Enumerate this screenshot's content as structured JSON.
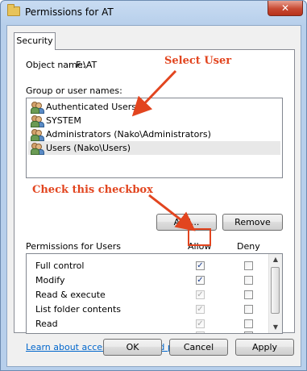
{
  "window": {
    "title": "Permissions for AT",
    "close_glyph": "✕"
  },
  "tab": {
    "label": "Security"
  },
  "object": {
    "label": "Object name:",
    "value": "F:\\AT"
  },
  "group_label": "Group or user names:",
  "users": [
    {
      "name": "Authenticated Users"
    },
    {
      "name": "SYSTEM"
    },
    {
      "name": "Administrators (Nako\\Administrators)"
    },
    {
      "name": "Users (Nako\\Users)",
      "selected": true
    }
  ],
  "buttons": {
    "add": "Add...",
    "remove": "Remove",
    "ok": "OK",
    "cancel": "Cancel",
    "apply": "Apply"
  },
  "permissions": {
    "label": "Permissions for Users",
    "allow_header": "Allow",
    "deny_header": "Deny",
    "rows": [
      {
        "name": "Full control",
        "allow": "checked",
        "deny": "unchecked"
      },
      {
        "name": "Modify",
        "allow": "checked",
        "deny": "unchecked"
      },
      {
        "name": "Read & execute",
        "allow": "checked-disabled",
        "deny": "unchecked"
      },
      {
        "name": "List folder contents",
        "allow": "checked-disabled",
        "deny": "unchecked"
      },
      {
        "name": "Read",
        "allow": "checked-disabled",
        "deny": "unchecked"
      }
    ]
  },
  "link": "Learn about access control and permissions",
  "annotations": {
    "select_user": "Select User",
    "check_checkbox": "Check this checkbox"
  },
  "colors": {
    "annotation": "#e2451f",
    "link": "#0066cc",
    "title_bar": "#b7cfeb"
  }
}
